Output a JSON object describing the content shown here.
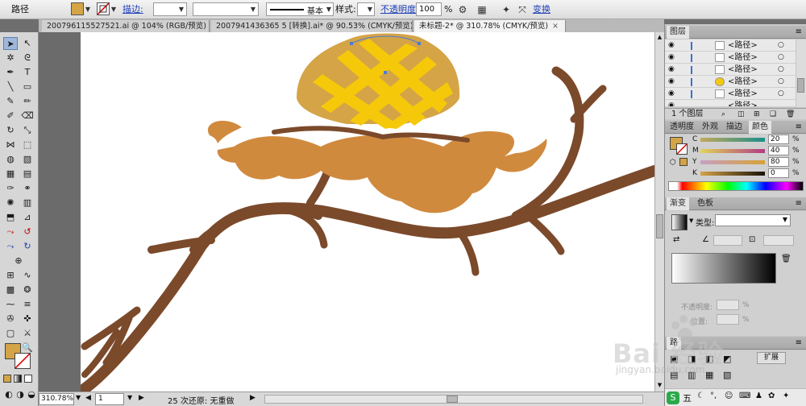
{
  "control_bar": {
    "object_type": "路径",
    "stroke_label": "描边:",
    "stroke_style": "基本",
    "style_label": "样式:",
    "opacity_label": "不透明度:",
    "opacity_value": "100",
    "opacity_unit": "%",
    "transform_label": "变换",
    "fill_color": "#d4a446"
  },
  "tabs": [
    {
      "label": "200796115527521.ai @ 104% (RGB/预览)",
      "close": "×"
    },
    {
      "label": "2007941436365 5 [转换].ai* @ 90.53% (CMYK/预览)",
      "close": "×"
    },
    {
      "label": "未标题-2* @ 310.78% (CMYK/预览)",
      "close": "×"
    }
  ],
  "status": {
    "zoom": "310.78%",
    "page": "1",
    "undo_text": "25 次还原: 无重做"
  },
  "layers_panel": {
    "title": "图层",
    "rows": [
      "<路径>",
      "<路径>",
      "<路径>",
      "<路径>",
      "<路径>",
      "<路径>"
    ],
    "footer": "1 个图层"
  },
  "color_panel": {
    "tabs": [
      "透明度",
      "外观",
      "描边",
      "颜色"
    ],
    "channels": [
      {
        "name": "C",
        "value": "20"
      },
      {
        "name": "M",
        "value": "40"
      },
      {
        "name": "Y",
        "value": "80"
      },
      {
        "name": "K",
        "value": "0"
      }
    ]
  },
  "gradient_panel": {
    "tabs": [
      "渐变",
      "色板"
    ],
    "type_label": "类型:",
    "opacity_label": "不透明度:",
    "location_label": "位置:",
    "percent": "%"
  },
  "bottom_panel": {
    "title": "路",
    "expand_label": "扩展"
  },
  "watermark": {
    "brand": "Bai 经验",
    "url": "jingyan.baidu.com"
  },
  "colors": {
    "branch": "#7b4a2b",
    "cushion": "#d08a3e",
    "cap": "#d4a446",
    "cap_stripes": "#f5c90a"
  }
}
